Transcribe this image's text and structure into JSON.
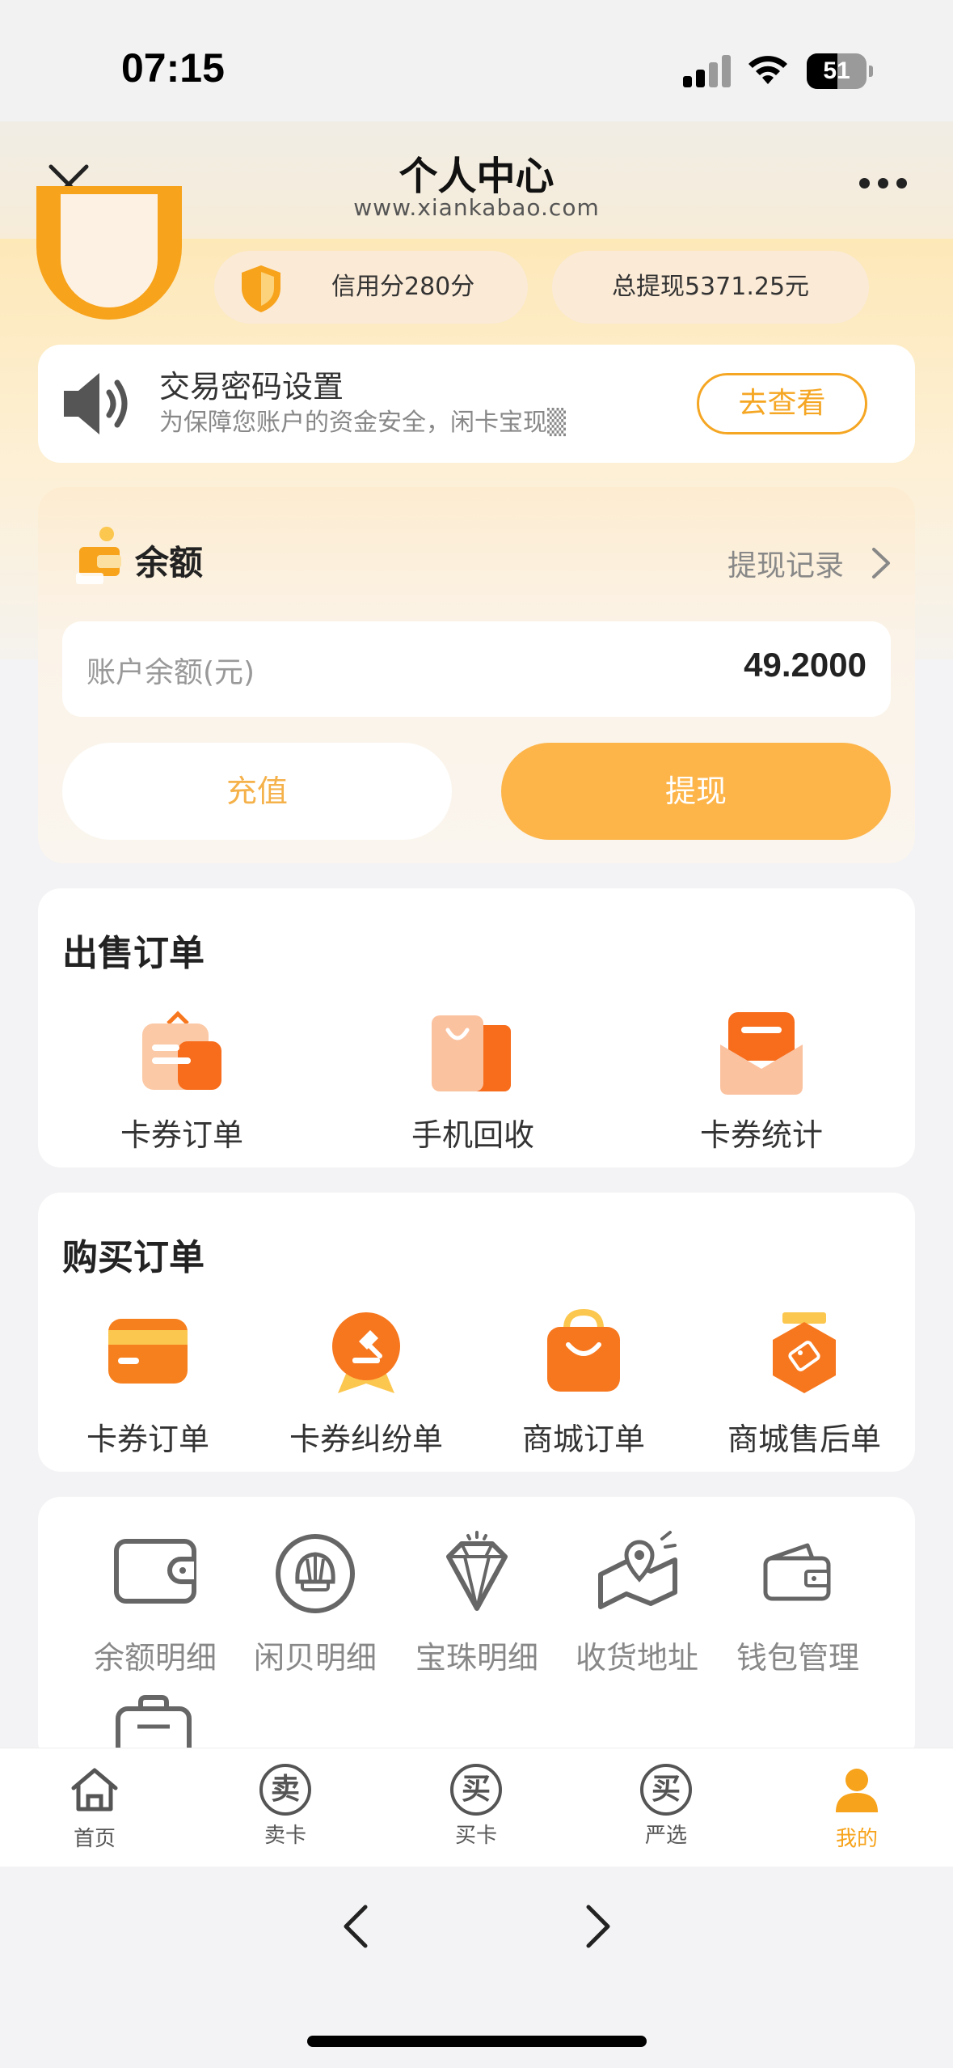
{
  "status_bar": {
    "time": "07:15",
    "battery": "51",
    "battery_level": 0.51
  },
  "header": {
    "title": "个人中心",
    "subtitle": "www.xiankabao.com"
  },
  "profile": {
    "credit": "信用分280分",
    "total_withdraw": "总提现5371.25元"
  },
  "notice": {
    "title": "交易密码设置",
    "text": "为保障您账户的资金安全，闲卡宝现▒",
    "button": "去查看"
  },
  "balance": {
    "title": "余额",
    "history_link": "提现记录",
    "label": "账户余额(元)",
    "value": "49.2000",
    "recharge": "充值",
    "withdraw": "提现"
  },
  "sell_orders": {
    "title": "出售订单",
    "items": [
      {
        "label": "卡券订单",
        "icon": "card-bag-icon"
      },
      {
        "label": "手机回收",
        "icon": "shopping-bag-icon"
      },
      {
        "label": "卡券统计",
        "icon": "envelope-icon"
      }
    ]
  },
  "buy_orders": {
    "title": "购买订单",
    "items": [
      {
        "label": "卡券订单",
        "icon": "card-icon"
      },
      {
        "label": "卡券纠纷单",
        "icon": "gavel-medal-icon"
      },
      {
        "label": "商城订单",
        "icon": "shop-bag-icon"
      },
      {
        "label": "商城售后单",
        "icon": "tag-badge-icon"
      }
    ]
  },
  "utilities": {
    "items": [
      {
        "label": "余额明细",
        "icon": "wallet-icon"
      },
      {
        "label": "闲贝明细",
        "icon": "shell-icon"
      },
      {
        "label": "宝珠明细",
        "icon": "diamond-icon"
      },
      {
        "label": "收货地址",
        "icon": "map-pin-icon"
      },
      {
        "label": "钱包管理",
        "icon": "purse-icon"
      }
    ]
  },
  "tabbar": {
    "items": [
      {
        "label": "首页",
        "glyph": ""
      },
      {
        "label": "卖卡",
        "glyph": "卖"
      },
      {
        "label": "买卡",
        "glyph": "买"
      },
      {
        "label": "严选",
        "glyph": "买"
      },
      {
        "label": "我的",
        "glyph": ""
      }
    ],
    "active_color": "#f7a31b"
  },
  "colors": {
    "accent": "#fdb54a",
    "orange": "#f7771e"
  }
}
